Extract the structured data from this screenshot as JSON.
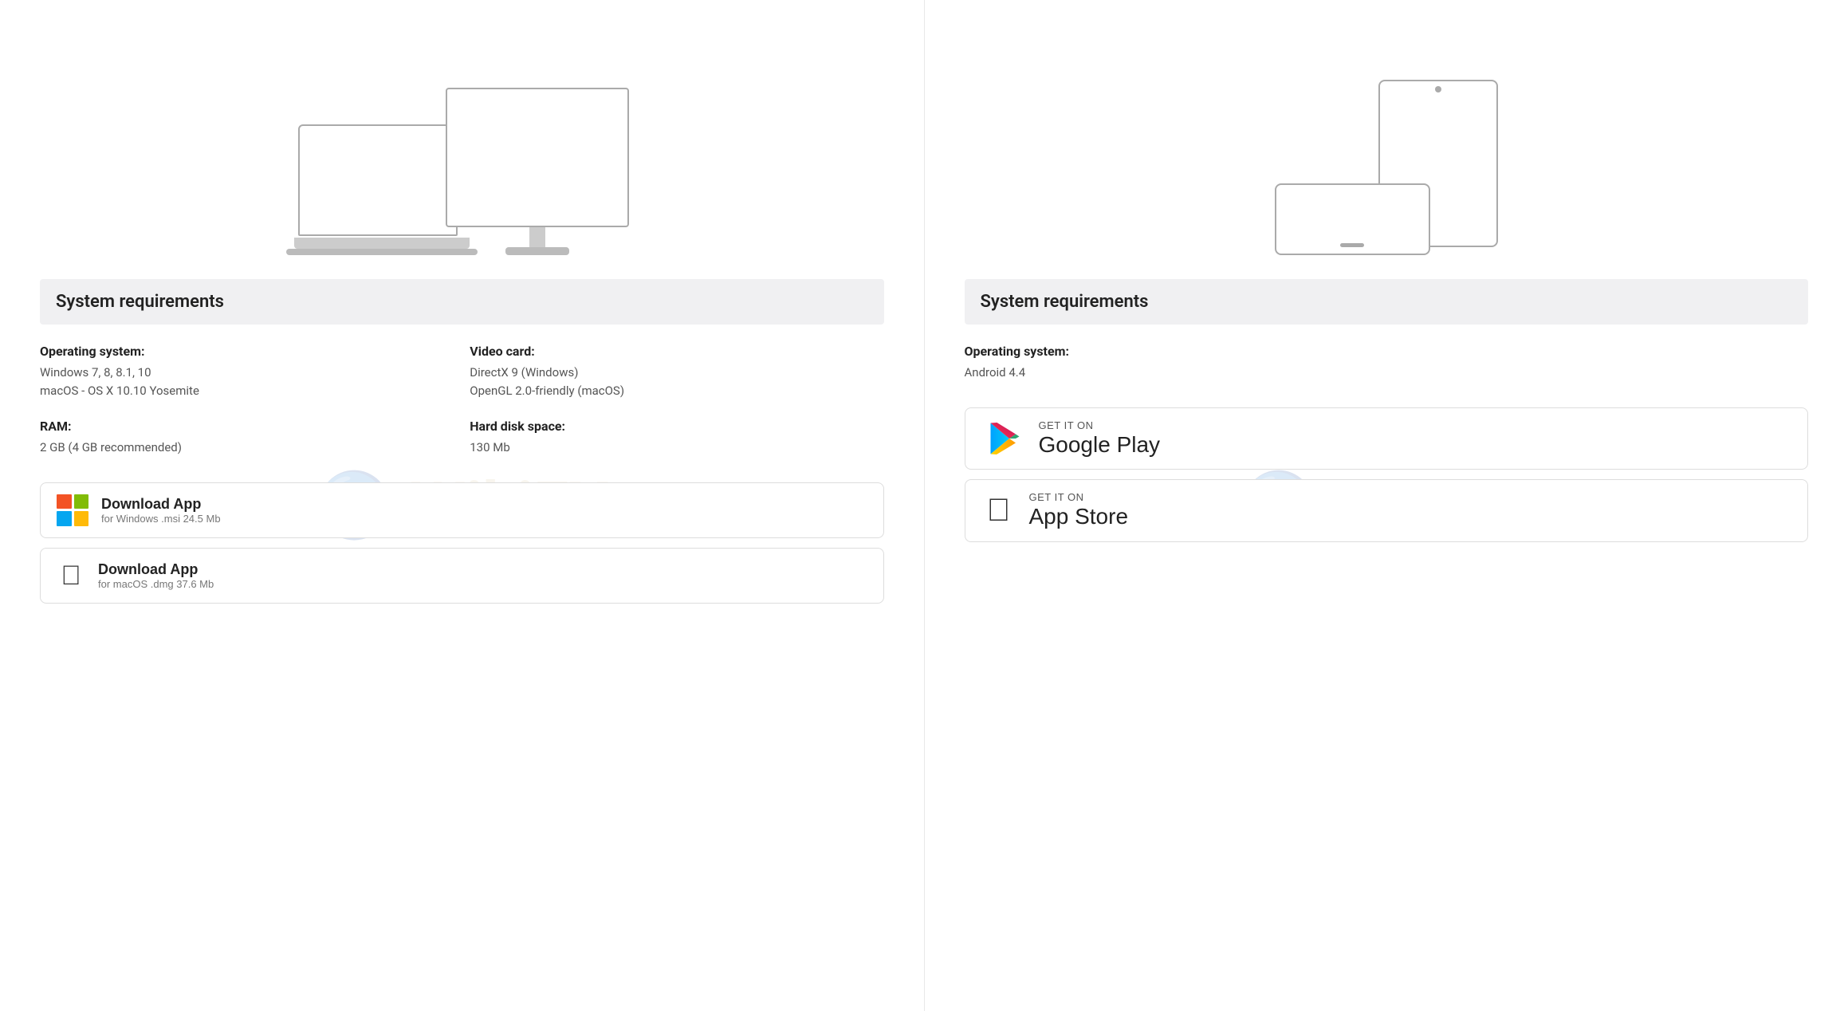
{
  "left_panel": {
    "watermark": "WikiFX",
    "system_requirements": {
      "header": "System requirements",
      "operating_system": {
        "label": "Operating system:",
        "values": [
          "Windows 7, 8, 8.1, 10",
          "macOS - OS X 10.10 Yosemite"
        ]
      },
      "video_card": {
        "label": "Video card:",
        "values": [
          "DirectX 9 (Windows)",
          "OpenGL 2.0-friendly (macOS)"
        ]
      },
      "ram": {
        "label": "RAM:",
        "values": [
          "2 GB (4 GB recommended)"
        ]
      },
      "hard_disk": {
        "label": "Hard disk space:",
        "values": [
          "130 Mb"
        ]
      }
    },
    "buttons": [
      {
        "id": "windows-download",
        "title": "Download App",
        "subtitle": "for Windows .msi 24.5 Mb",
        "icon_type": "windows"
      },
      {
        "id": "mac-download",
        "title": "Download App",
        "subtitle": "for macOS .dmg 37.6 Mb",
        "icon_type": "apple"
      }
    ]
  },
  "right_panel": {
    "watermark": "WikiFX",
    "system_requirements": {
      "header": "System requirements",
      "operating_system": {
        "label": "Operating system:",
        "values": [
          "Android 4.4"
        ]
      }
    },
    "store_buttons": [
      {
        "id": "google-play",
        "get_label": "GET IT ON",
        "store_name": "Google Play",
        "icon_type": "google-play"
      },
      {
        "id": "app-store",
        "get_label": "GET IT ON",
        "store_name": "App Store",
        "icon_type": "apple"
      }
    ]
  }
}
